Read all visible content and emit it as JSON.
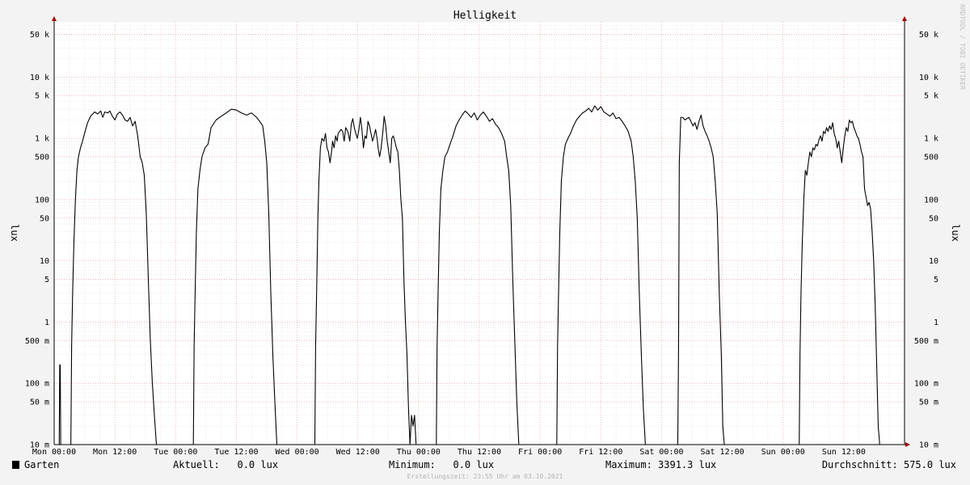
{
  "chart_data": {
    "type": "line",
    "title": "Helligkeit",
    "ylabel": "lux",
    "yscale": "log",
    "ylim": [
      0.01,
      80000
    ],
    "xlim": [
      "Mon 00:00",
      "Sun 24:00"
    ],
    "grid": true,
    "y_ticks": [
      {
        "value": 0.01,
        "label": "10 m"
      },
      {
        "value": 0.05,
        "label": "50 m"
      },
      {
        "value": 0.1,
        "label": "100 m"
      },
      {
        "value": 0.5,
        "label": "500 m"
      },
      {
        "value": 1,
        "label": "1"
      },
      {
        "value": 5,
        "label": "5"
      },
      {
        "value": 10,
        "label": "10"
      },
      {
        "value": 50,
        "label": "50"
      },
      {
        "value": 100,
        "label": "100"
      },
      {
        "value": 500,
        "label": "500"
      },
      {
        "value": 1000,
        "label": "1 k"
      },
      {
        "value": 5000,
        "label": "5 k"
      },
      {
        "value": 10000,
        "label": "10 k"
      },
      {
        "value": 50000,
        "label": "50 k"
      }
    ],
    "x_ticks": [
      {
        "hour": 0,
        "label": "Mon 00:00"
      },
      {
        "hour": 12,
        "label": "Mon 12:00"
      },
      {
        "hour": 24,
        "label": "Tue 00:00"
      },
      {
        "hour": 36,
        "label": "Tue 12:00"
      },
      {
        "hour": 48,
        "label": "Wed 00:00"
      },
      {
        "hour": 60,
        "label": "Wed 12:00"
      },
      {
        "hour": 72,
        "label": "Thu 00:00"
      },
      {
        "hour": 84,
        "label": "Thu 12:00"
      },
      {
        "hour": 96,
        "label": "Fri 00:00"
      },
      {
        "hour": 108,
        "label": "Fri 12:00"
      },
      {
        "hour": 120,
        "label": "Sat 00:00"
      },
      {
        "hour": 132,
        "label": "Sat 12:00"
      },
      {
        "hour": 144,
        "label": "Sun 00:00"
      },
      {
        "hour": 156,
        "label": "Sun 12:00"
      }
    ],
    "series": [
      {
        "name": "Garten",
        "color": "#000000",
        "x_hours": [
          0,
          1.0,
          1.1,
          1.2,
          1.3,
          3.3,
          3.45,
          3.65,
          3.9,
          4.2,
          4.5,
          4.8,
          5.2,
          5.6,
          6.0,
          6.6,
          7.2,
          8.0,
          8.6,
          9.2,
          9.6,
          10.0,
          10.6,
          11.0,
          11.5,
          12.0,
          12.5,
          13.0,
          13.5,
          14.0,
          14.5,
          15.0,
          15.5,
          16.0,
          16.5,
          17.0,
          17.4,
          17.8,
          18.2,
          18.6,
          19.0,
          19.4,
          19.8,
          20.2,
          20.6,
          21.0,
          27.5,
          27.65,
          27.85,
          28.1,
          28.4,
          28.8,
          29.2,
          29.8,
          30.4,
          31.0,
          32.0,
          33.0,
          34.0,
          35.0,
          36.0,
          37.0,
          38.0,
          39.0,
          40.0,
          40.6,
          41.2,
          41.6,
          42.0,
          42.4,
          42.8,
          43.2,
          43.6,
          44.0,
          44.4,
          44.8,
          45.2,
          51.5,
          51.65,
          51.9,
          52.1,
          52.3,
          52.6,
          52.9,
          53.3,
          53.6,
          53.9,
          54.2,
          54.5,
          54.8,
          55.0,
          55.3,
          55.6,
          55.9,
          56.1,
          56.4,
          56.7,
          57.0,
          57.3,
          57.6,
          57.8,
          58.0,
          58.2,
          58.4,
          58.7,
          59.0,
          59.3,
          59.6,
          59.9,
          60.2,
          60.5,
          60.8,
          61.1,
          61.4,
          61.7,
          62.0,
          62.3,
          62.6,
          62.9,
          63.2,
          63.5,
          63.8,
          64.0,
          64.3,
          64.6,
          64.9,
          65.2,
          65.5,
          65.8,
          66.1,
          66.4,
          66.7,
          67.0,
          67.3,
          67.6,
          67.9,
          68.2,
          68.5,
          68.8,
          69.1,
          69.4,
          69.7,
          70.0,
          70.3,
          70.6,
          70.9,
          71.2,
          71.5,
          71.9,
          72.2,
          72.5,
          72.8,
          73.0,
          73.3,
          73.5,
          75.5,
          75.65,
          75.85,
          76.1,
          76.4,
          76.8,
          77.2,
          77.7,
          78.2,
          78.8,
          79.4,
          80.0,
          80.6,
          81.2,
          81.8,
          82.4,
          83.0,
          83.6,
          84.2,
          84.8,
          85.4,
          86.0,
          86.6,
          87.2,
          87.8,
          88.4,
          89.0,
          89.4,
          89.8,
          90.2,
          90.6,
          91.0,
          91.4,
          91.8,
          92.2,
          92.6,
          93.0,
          99.3,
          99.45,
          99.65,
          99.9,
          100.2,
          100.6,
          101.0,
          101.5,
          102.0,
          102.6,
          103.2,
          103.8,
          104.4,
          105.0,
          105.6,
          106.2,
          106.8,
          107.4,
          108.0,
          108.6,
          109.2,
          109.8,
          110.4,
          111.0,
          111.6,
          112.2,
          112.8,
          113.4,
          114.0,
          114.4,
          114.8,
          115.2,
          115.6,
          116.0,
          116.4,
          116.8,
          117.2,
          123.2,
          123.35,
          123.5,
          123.8,
          124.2,
          124.6,
          125.0,
          125.4,
          125.8,
          126.2,
          126.6,
          127.0,
          127.4,
          127.8,
          128.2,
          128.6,
          129.0,
          129.4,
          129.8,
          130.2,
          130.6,
          131.0,
          131.4,
          131.8,
          132.1,
          132.4,
          132.8,
          133.2,
          133.6,
          134.0,
          134.4,
          134.8,
          135.2,
          135.6,
          136.0,
          136.4,
          136.8,
          137.2,
          137.6,
          138.0,
          138.4,
          138.8,
          139.2,
          139.6,
          140.0,
          140.4,
          140.8,
          141.2,
          141.6,
          142.0,
          142.4,
          142.8,
          143.2,
          147.2,
          147.35,
          147.55,
          147.8,
          148.1,
          148.4,
          148.7,
          149.0,
          149.3,
          149.6,
          149.9,
          150.2,
          150.5,
          150.8,
          151.1,
          151.4,
          151.7,
          152.0,
          152.3,
          152.6,
          152.9,
          153.2,
          153.5,
          153.8,
          154.1,
          154.4,
          154.7,
          155.0,
          155.3,
          155.6,
          155.9,
          156.2,
          156.5,
          156.8,
          157.1,
          157.4,
          157.7,
          158.0,
          158.3,
          158.6,
          158.9,
          159.2,
          159.5,
          159.8,
          160.1,
          160.4,
          160.7,
          161.0,
          161.3,
          161.6,
          161.9,
          162.2,
          162.5,
          162.8,
          163.1,
          163.4,
          163.7,
          164.0,
          164.3,
          164.6,
          164.9,
          165.2,
          165.5,
          165.8,
          166.1,
          166.4,
          166.7,
          167.0,
          167.3,
          167.6,
          167.9,
          168
        ],
        "values": [
          0.01,
          0.01,
          0.2,
          0.2,
          0.01,
          0.01,
          0.4,
          3,
          20,
          100,
          300,
          500,
          700,
          900,
          1200,
          1800,
          2300,
          2700,
          2500,
          2800,
          2200,
          2700,
          2600,
          2800,
          2300,
          2000,
          2500,
          2700,
          2400,
          2000,
          1900,
          2200,
          1600,
          1900,
          1100,
          500,
          400,
          250,
          60,
          5,
          0.5,
          0.1,
          0.03,
          0.01,
          0.01,
          0.01,
          0.01,
          0.4,
          3,
          30,
          150,
          300,
          500,
          700,
          800,
          1500,
          2000,
          2300,
          2600,
          3000,
          2900,
          2600,
          2400,
          2600,
          2200,
          1900,
          1600,
          900,
          400,
          60,
          3,
          0.3,
          0.05,
          0.01,
          0.01,
          0.01,
          0.01,
          0.01,
          0.4,
          5,
          50,
          200,
          700,
          1000,
          900,
          1200,
          700,
          600,
          400,
          600,
          900,
          700,
          1100,
          900,
          1200,
          1300,
          1400,
          1300,
          900,
          1500,
          1400,
          1300,
          1100,
          900,
          1700,
          2100,
          1500,
          1200,
          1000,
          1400,
          2200,
          1400,
          700,
          1100,
          1000,
          1900,
          1600,
          1200,
          900,
          1100,
          1400,
          1000,
          700,
          500,
          700,
          1200,
          2300,
          1600,
          900,
          600,
          400,
          1000,
          1100,
          900,
          700,
          600,
          300,
          100,
          50,
          5,
          1,
          0.3,
          0.04,
          0.01,
          0.03,
          0.02,
          0.03,
          0.01,
          0.01,
          0.01,
          0.01,
          0.01,
          0.01,
          0.01,
          0.01,
          0.01,
          0.4,
          3,
          30,
          150,
          300,
          500,
          600,
          800,
          1100,
          1600,
          2000,
          2400,
          2800,
          2500,
          2200,
          2600,
          2000,
          2400,
          2700,
          2300,
          1900,
          2100,
          1700,
          1500,
          1200,
          900,
          500,
          300,
          80,
          5,
          0.5,
          0.05,
          0.01,
          0.01,
          0.01,
          0.01,
          0.01,
          0.4,
          3,
          30,
          200,
          500,
          800,
          1000,
          1200,
          1600,
          2000,
          2300,
          2600,
          2800,
          3100,
          2700,
          3400,
          2900,
          3300,
          2700,
          2500,
          2300,
          2600,
          2100,
          2200,
          1900,
          1600,
          1300,
          900,
          500,
          200,
          50,
          3,
          0.3,
          0.04,
          0.01,
          0.01,
          0.01,
          0.3,
          400,
          2200,
          2200,
          2000,
          2100,
          2200,
          1900,
          1600,
          1800,
          1400,
          1900,
          2400,
          1600,
          1300,
          1100,
          900,
          700,
          500,
          200,
          60,
          3,
          0.3,
          0.02,
          0.01,
          0.01,
          0.01,
          0.01,
          0.01,
          0.01,
          0.01,
          0.01,
          0.01,
          0.01,
          0.01,
          0.01,
          0.01,
          0.01,
          0.01,
          0.01,
          0.01,
          0.01,
          0.01,
          0.01,
          0.01,
          0.01,
          0.01,
          0.01,
          0.01,
          0.01,
          0.01,
          0.01,
          0.01,
          0.3,
          3,
          20,
          100,
          300,
          250,
          400,
          600,
          500,
          700,
          650,
          800,
          750,
          950,
          1100,
          900,
          1300,
          1200,
          1500,
          1300,
          1600,
          1400,
          1800,
          1200,
          1000,
          700,
          900,
          600,
          400,
          700,
          1100,
          1500,
          1300,
          2000,
          1800,
          1900,
          1500,
          1300,
          1100,
          1000,
          800,
          600,
          500,
          150,
          110,
          80,
          90,
          70,
          30,
          10,
          2,
          0.2,
          0.02,
          0.01,
          0.01,
          0.01,
          0.01,
          0.01,
          0.01,
          0.01,
          0.01,
          0.01,
          0.01,
          0.01,
          0.01,
          0.01,
          0.01,
          0.01,
          0.01,
          0.01,
          0.01
        ]
      }
    ]
  },
  "watermark": "RRDTOOL / TOBI OETIKER",
  "legend": {
    "label": "Garten",
    "color": "#000000",
    "current": "Aktuell:   0.0 lux",
    "minimum": "Minimum:   0.0 lux",
    "maximum": "Maximum: 3391.3 lux",
    "average": "Durchschnitt: 575.0 lux"
  },
  "credit": "Erstellungszeit: 23:55 Uhr am 03.10.2021"
}
